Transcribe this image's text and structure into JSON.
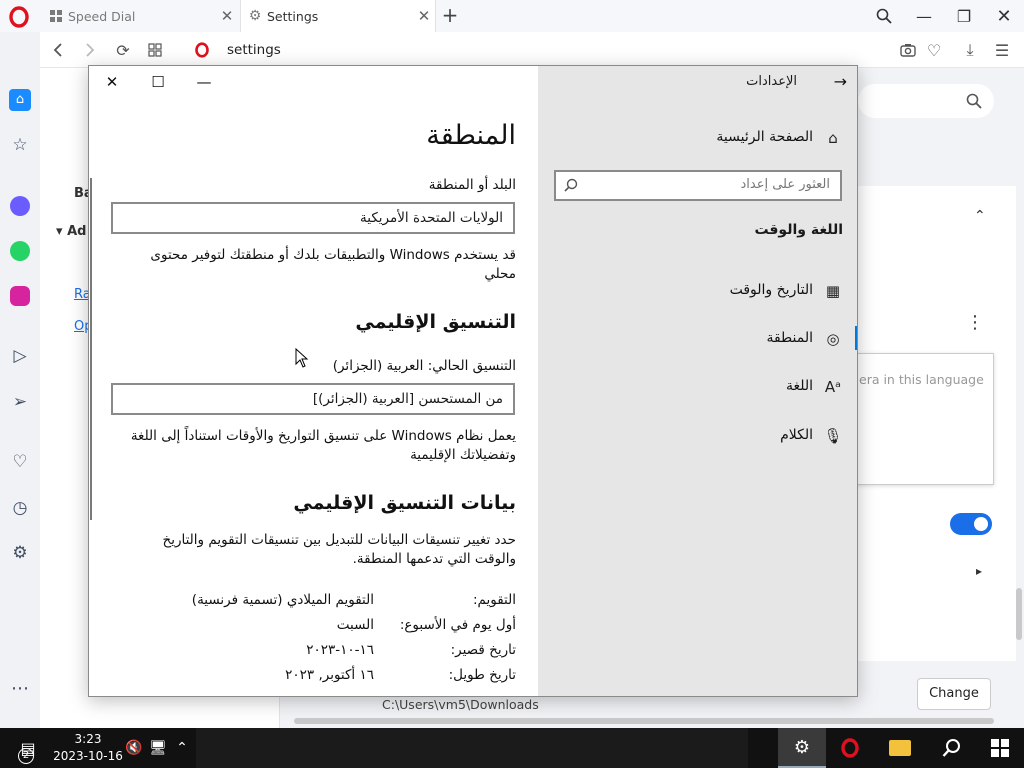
{
  "browser": {
    "tabs": [
      {
        "label": "Speed Dial"
      },
      {
        "label": "Settings"
      }
    ],
    "new_tab": "+",
    "address": "settings"
  },
  "opera_page": {
    "partial_left_1": "Ba",
    "partial_left_2": "Ad",
    "partial_left_3": "Ra",
    "partial_left_4": "Op",
    "language_placeholder_fragment": "era in this language",
    "change_button": "Change",
    "download_path": "C:\\Users\\vm5\\Downloads",
    "toggle_on": true
  },
  "win": {
    "back_title": "الإعدادات",
    "home": "الصفحة الرئيسية",
    "search_placeholder": "العثور على إعداد",
    "section": "اللغة والوقت",
    "nav": [
      {
        "label": "التاريخ والوقت",
        "icon": "calendar-clock-icon"
      },
      {
        "label": "المنطقة",
        "icon": "globe-icon"
      },
      {
        "label": "اللغة",
        "icon": "language-icon"
      },
      {
        "label": "الكلام",
        "icon": "microphone-icon"
      }
    ],
    "page_title": "المنطقة",
    "country_label": "البلد أو المنطقة",
    "country_value": "الولايات المتحدة الأمريكية",
    "country_desc": "قد يستخدم Windows والتطبيقات بلدك أو منطقتك لتوفير محتوى محلي",
    "format_title": "التنسيق الإقليمي",
    "current_format": "التنسيق الحالي: العربية (الجزائر)",
    "format_value": "من المستحسن [العربية (الجزائر)]",
    "format_desc": "يعمل نظام Windows على تنسيق التواريخ والأوقات استناداً إلى اللغة وتفضيلاتك الإقليمية",
    "data_title": "بيانات التنسيق الإقليمي",
    "data_desc": "حدد تغيير تنسيقات البيانات للتبديل بين تنسيقات التقويم والتاريخ والوقت التي تدعمها المنطقة.",
    "rows": [
      {
        "label": "التقويم:",
        "value": "التقويم الميلادي (تسمية فرنسية)"
      },
      {
        "label": "أول يوم في الأسبوع:",
        "value": "السبت"
      },
      {
        "label": "تاريخ قصير:",
        "value": "١٦-١٠-٢٠٢٣"
      },
      {
        "label": "تاريخ طويل:",
        "value": "١٦ أكتوبر, ٢٠٢٣"
      }
    ]
  },
  "taskbar": {
    "time": "3:23",
    "date": "2023-10-16",
    "notification_count": "2"
  },
  "colors": {
    "accent": "#0078d7",
    "opera_red": "#e0101f",
    "taskbar": "#111111",
    "settings_nav_bg": "#e6e6e6"
  }
}
